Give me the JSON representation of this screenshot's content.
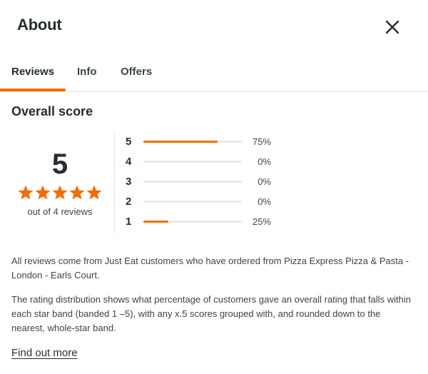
{
  "header": {
    "title": "About",
    "close_icon": "close-icon"
  },
  "tabs": [
    {
      "label": "Reviews",
      "active": true
    },
    {
      "label": "Info",
      "active": false
    },
    {
      "label": "Offers",
      "active": false
    }
  ],
  "overall": {
    "title": "Overall score",
    "score": "5",
    "stars": 5,
    "stars_filled": 5,
    "subtitle": "out of 4 reviews",
    "distribution": [
      {
        "star": "5",
        "percent_label": "75%",
        "fraction": 0.75
      },
      {
        "star": "4",
        "percent_label": "0%",
        "fraction": 0
      },
      {
        "star": "3",
        "percent_label": "0%",
        "fraction": 0
      },
      {
        "star": "2",
        "percent_label": "0%",
        "fraction": 0
      },
      {
        "star": "1",
        "percent_label": "25%",
        "fraction": 0.25
      }
    ]
  },
  "info": {
    "para1": "All reviews come from Just Eat customers who have ordered from Pizza Express Pizza & Pasta - London - Earls Court.",
    "para2": "The rating distribution shows what percentage of customers gave an overall rating that falls within each star band (banded 1 –5), with any x.5 scores grouped with, and rounded down to the nearest, whole-star band.",
    "link": "Find out more"
  },
  "colors": {
    "accent": "#f36d00",
    "text": "#242e30",
    "track": "#ede9e4"
  }
}
